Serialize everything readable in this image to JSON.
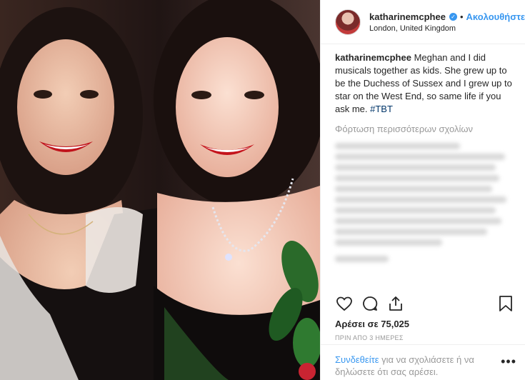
{
  "header": {
    "username": "katharinemcphee",
    "follow_label": "Ακολουθήστε",
    "dot": "•",
    "location": "London, United Kingdom"
  },
  "caption": {
    "username": "katharinemcphee",
    "text": "Meghan and I did musicals together as kids. She grew up to be the Duchess of Sussex and I grew up to star on the West End, so same life if you ask me. ",
    "hashtag": "#TBT"
  },
  "load_more_comments": "Φόρτωση περισσότερων σχολίων",
  "likes_label": "Αρέσει σε 75,025",
  "timestamp": "ΠΡΙΝ ΑΠΟ 3 ΗΜΕΡΕΣ",
  "login_prompt": {
    "link": "Συνδεθείτε",
    "text": " για να σχολιάσετε ή να δηλώσετε ότι σας αρέσει."
  },
  "more_label": "•••",
  "icons": [
    "heart-icon",
    "comment-icon",
    "share-icon",
    "bookmark-icon",
    "verified-icon"
  ],
  "colors": {
    "accent": "#3897f0",
    "text": "#262626",
    "muted": "#999999",
    "border": "#efefef"
  }
}
